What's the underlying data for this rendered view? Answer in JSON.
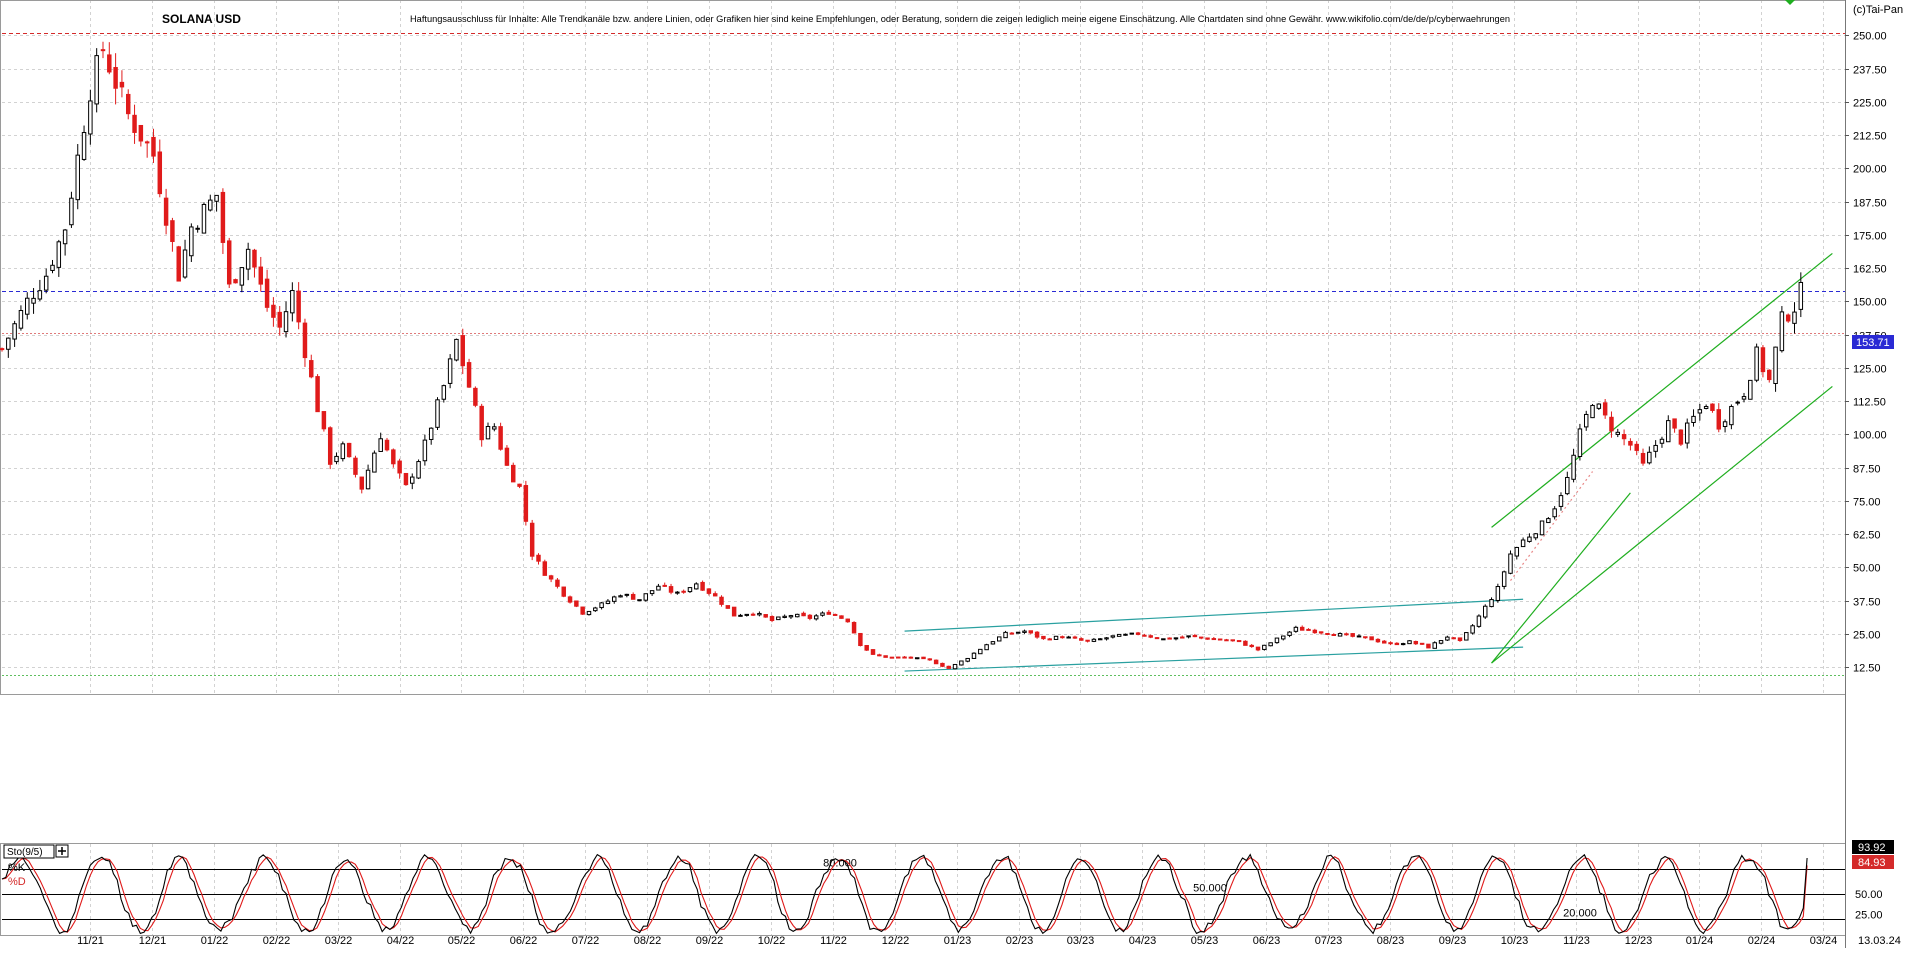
{
  "chart_data": {
    "type": "candlestick",
    "title": "SOLANA USD",
    "disclaimer": "Haftungsausschluss für Inhalte: Alle Trendkanäle bzw. andere Linien, oder Grafiken hier sind keine Empfehlungen, oder Beratung, sondern die zeigen lediglich meine eigene Einschätzung. Alle Chartdaten sind ohne Gewähr. www.wikifolio.com/de/de/p/cyberwaehrungen",
    "copyright": "(c)Tai-Pan",
    "date_label": "13.03.24",
    "ylim": [
      5,
      255
    ],
    "y_ticks": [
      "250.00",
      "237.50",
      "225.00",
      "212.50",
      "200.00",
      "187.50",
      "175.00",
      "162.50",
      "150.00",
      "137.50",
      "125.00",
      "112.50",
      "100.00",
      "87.50",
      "75.00",
      "62.50",
      "50.00",
      "37.50",
      "25.00",
      "12.50"
    ],
    "x_ticks": [
      "11/21",
      "12/21",
      "01/22",
      "02/22",
      "03/22",
      "04/22",
      "05/22",
      "06/22",
      "07/22",
      "08/22",
      "09/22",
      "10/22",
      "11/22",
      "12/22",
      "01/23",
      "02/23",
      "03/23",
      "04/23",
      "05/23",
      "06/23",
      "07/23",
      "08/23",
      "09/23",
      "10/23",
      "11/23",
      "12/23",
      "01/24",
      "02/24",
      "03/24"
    ],
    "last_price": 153.71,
    "last_price_label": "153.71",
    "reference_levels": [
      {
        "value": 251,
        "color": "#d42a2a",
        "style": "dashed"
      },
      {
        "value": 153.71,
        "color": "#2a2ad4",
        "style": "dashed"
      },
      {
        "value": 138,
        "color": "#e07a7a",
        "style": "dotted"
      },
      {
        "value": 9.5,
        "color": "#5fbf5f",
        "style": "dotted"
      }
    ],
    "price_path": [
      [
        0,
        132
      ],
      [
        4,
        150
      ],
      [
        7,
        160
      ],
      [
        10,
        178
      ],
      [
        14,
        230
      ],
      [
        16,
        245
      ],
      [
        20,
        220
      ],
      [
        24,
        205
      ],
      [
        28,
        160
      ],
      [
        30,
        178
      ],
      [
        34,
        190
      ],
      [
        36,
        155
      ],
      [
        39,
        170
      ],
      [
        42,
        148
      ],
      [
        44,
        140
      ],
      [
        46,
        153
      ],
      [
        50,
        110
      ],
      [
        52,
        90
      ],
      [
        54,
        95
      ],
      [
        57,
        80
      ],
      [
        60,
        100
      ],
      [
        62,
        88
      ],
      [
        64,
        80
      ],
      [
        67,
        96
      ],
      [
        70,
        118
      ],
      [
        72,
        135
      ],
      [
        74,
        118
      ],
      [
        76,
        100
      ],
      [
        78,
        103
      ],
      [
        80,
        88
      ],
      [
        82,
        80
      ],
      [
        84,
        55
      ],
      [
        86,
        48
      ],
      [
        89,
        40
      ],
      [
        92,
        33
      ],
      [
        95,
        36
      ],
      [
        98,
        40
      ],
      [
        101,
        38
      ],
      [
        104,
        43
      ],
      [
        107,
        40
      ],
      [
        110,
        44
      ],
      [
        113,
        39
      ],
      [
        116,
        32
      ],
      [
        119,
        33
      ],
      [
        122,
        30
      ],
      [
        125,
        32
      ],
      [
        128,
        31
      ],
      [
        131,
        33
      ],
      [
        134,
        30
      ],
      [
        136,
        21
      ],
      [
        138,
        17
      ],
      [
        141,
        16
      ],
      [
        144,
        16
      ],
      [
        147,
        15
      ],
      [
        150,
        12
      ],
      [
        153,
        16
      ],
      [
        156,
        21
      ],
      [
        159,
        25
      ],
      [
        162,
        26
      ],
      [
        165,
        23
      ],
      [
        168,
        24
      ],
      [
        172,
        22
      ],
      [
        176,
        24
      ],
      [
        180,
        25
      ],
      [
        184,
        23
      ],
      [
        188,
        24
      ],
      [
        192,
        23
      ],
      [
        196,
        22
      ],
      [
        199,
        19
      ],
      [
        202,
        23
      ],
      [
        205,
        27
      ],
      [
        208,
        26
      ],
      [
        211,
        25
      ],
      [
        214,
        24
      ],
      [
        217,
        23
      ],
      [
        220,
        21
      ],
      [
        223,
        22
      ],
      [
        226,
        20
      ],
      [
        229,
        24
      ],
      [
        231,
        22
      ],
      [
        233,
        28
      ],
      [
        235,
        35
      ],
      [
        237,
        42
      ],
      [
        239,
        55
      ],
      [
        241,
        60
      ],
      [
        244,
        66
      ],
      [
        246,
        73
      ],
      [
        248,
        83
      ],
      [
        250,
        100
      ],
      [
        252,
        113
      ],
      [
        254,
        106
      ],
      [
        256,
        100
      ],
      [
        258,
        96
      ],
      [
        260,
        88
      ],
      [
        262,
        96
      ],
      [
        264,
        104
      ],
      [
        266,
        98
      ],
      [
        268,
        106
      ],
      [
        270,
        112
      ],
      [
        272,
        104
      ],
      [
        274,
        110
      ],
      [
        276,
        116
      ],
      [
        278,
        130
      ],
      [
        280,
        120
      ],
      [
        282,
        143
      ],
      [
        284,
        148
      ],
      [
        285,
        153.71
      ]
    ],
    "trend_lines": [
      {
        "points": [
          [
            143,
            26
          ],
          [
            241,
            38
          ]
        ],
        "color": "#2aa0a0"
      },
      {
        "points": [
          [
            143,
            11
          ],
          [
            241,
            20
          ]
        ],
        "color": "#2aa0a0"
      },
      {
        "points": [
          [
            236,
            65
          ],
          [
            290,
            168
          ]
        ],
        "color": "#1fae1f"
      },
      {
        "points": [
          [
            236,
            14
          ],
          [
            290,
            118
          ]
        ],
        "color": "#1fae1f"
      },
      {
        "points": [
          [
            236,
            14
          ],
          [
            258,
            78
          ]
        ],
        "color": "#1fae1f"
      },
      {
        "points": [
          [
            239,
            45
          ],
          [
            252,
            86
          ]
        ],
        "color": "#e88888",
        "style": "dotted"
      }
    ],
    "stochastic": {
      "indicator_label": "Sto(9/5)",
      "k_label": "%K",
      "d_label": "%D",
      "ylim": [
        0,
        100
      ],
      "levels": [
        {
          "value": 80,
          "label": "80.000"
        },
        {
          "value": 50,
          "label": "50.000"
        },
        {
          "value": 20,
          "label": "20.000"
        }
      ],
      "y_ticks": [
        "50.00",
        "25.00"
      ],
      "k_value": 93.92,
      "k_value_label": "93.92",
      "d_value": 84.93,
      "d_value_label": "84.93"
    }
  }
}
